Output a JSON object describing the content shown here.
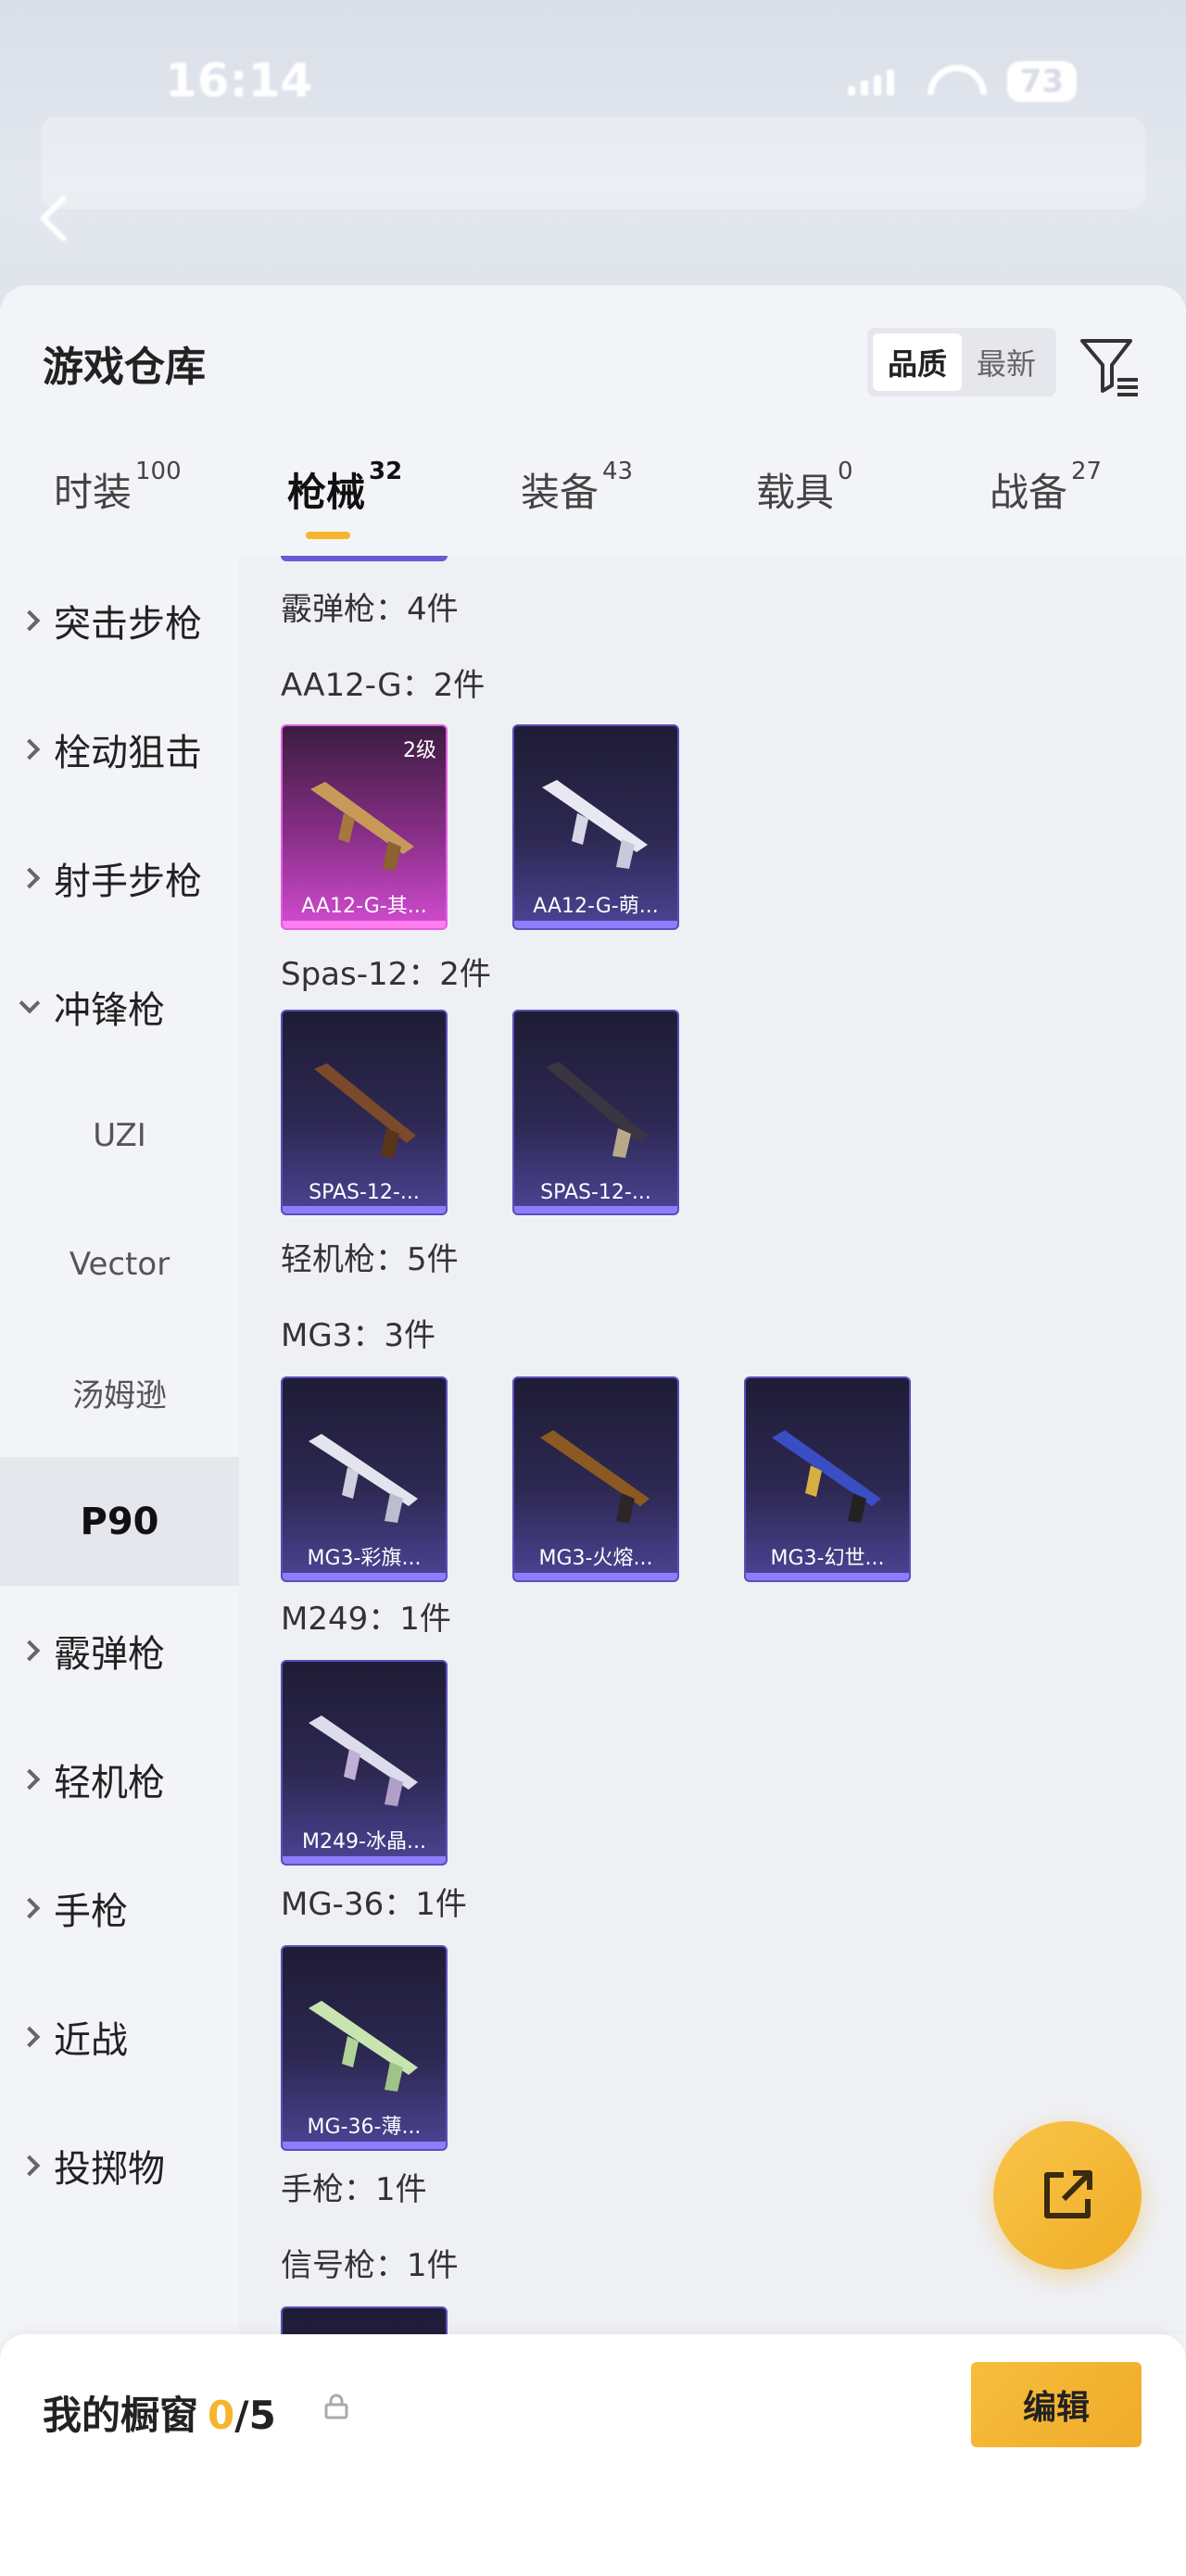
{
  "status_bar": {
    "time": "16:14",
    "battery": "73"
  },
  "header": {
    "title": "游戏仓库",
    "sort_options": [
      "品质",
      "最新"
    ],
    "active_sort": "品质"
  },
  "tabs": [
    {
      "label": "时装",
      "count": "100"
    },
    {
      "label": "枪械",
      "count": "32"
    },
    {
      "label": "装备",
      "count": "43"
    },
    {
      "label": "载具",
      "count": "0"
    },
    {
      "label": "战备",
      "count": "27"
    }
  ],
  "active_tab": "枪械",
  "sidebar": {
    "items": [
      {
        "label": "突击步枪"
      },
      {
        "label": "栓动狙击"
      },
      {
        "label": "射手步枪"
      },
      {
        "label": "冲锋枪"
      },
      {
        "label": "UZI"
      },
      {
        "label": "Vector"
      },
      {
        "label": "汤姆逊"
      },
      {
        "label": "P90"
      },
      {
        "label": "霰弹枪"
      },
      {
        "label": "轻机枪"
      },
      {
        "label": "手枪"
      },
      {
        "label": "近战"
      },
      {
        "label": "投掷物"
      }
    ],
    "selected": "P90"
  },
  "content": {
    "groups": [
      {
        "label": "霰弹枪：4件"
      },
      {
        "label": "AA12-G：2件"
      },
      {
        "label": "Spas-12：2件"
      },
      {
        "label": "轻机枪：5件"
      },
      {
        "label": "MG3：3件"
      },
      {
        "label": "M249：1件"
      },
      {
        "label": "MG-36：1件"
      },
      {
        "label": "手枪：1件"
      },
      {
        "label": "信号枪：1件"
      }
    ],
    "cards": [
      {
        "name": "AA12-G-其...",
        "level": "2级",
        "rarity": "pink"
      },
      {
        "name": "AA12-G-萌...",
        "level": "",
        "rarity": "purple"
      },
      {
        "name": "SPAS-12-...",
        "level": "",
        "rarity": "purple"
      },
      {
        "name": "SPAS-12-...",
        "level": "",
        "rarity": "purple"
      },
      {
        "name": "MG3-彩旗...",
        "level": "",
        "rarity": "purple"
      },
      {
        "name": "MG3-火熔...",
        "level": "",
        "rarity": "purple"
      },
      {
        "name": "MG3-幻世...",
        "level": "",
        "rarity": "purple"
      },
      {
        "name": "M249-冰晶...",
        "level": "",
        "rarity": "purple"
      },
      {
        "name": "MG-36-薄...",
        "level": "",
        "rarity": "purple"
      }
    ]
  },
  "bottom_bar": {
    "title": "我的橱窗",
    "count_current": "0",
    "count_max": "/5",
    "edit_label": "编辑"
  },
  "colors": {
    "accent": "#f5b52e",
    "card_purple": "#4c4495",
    "card_pink": "#d24bd0"
  }
}
